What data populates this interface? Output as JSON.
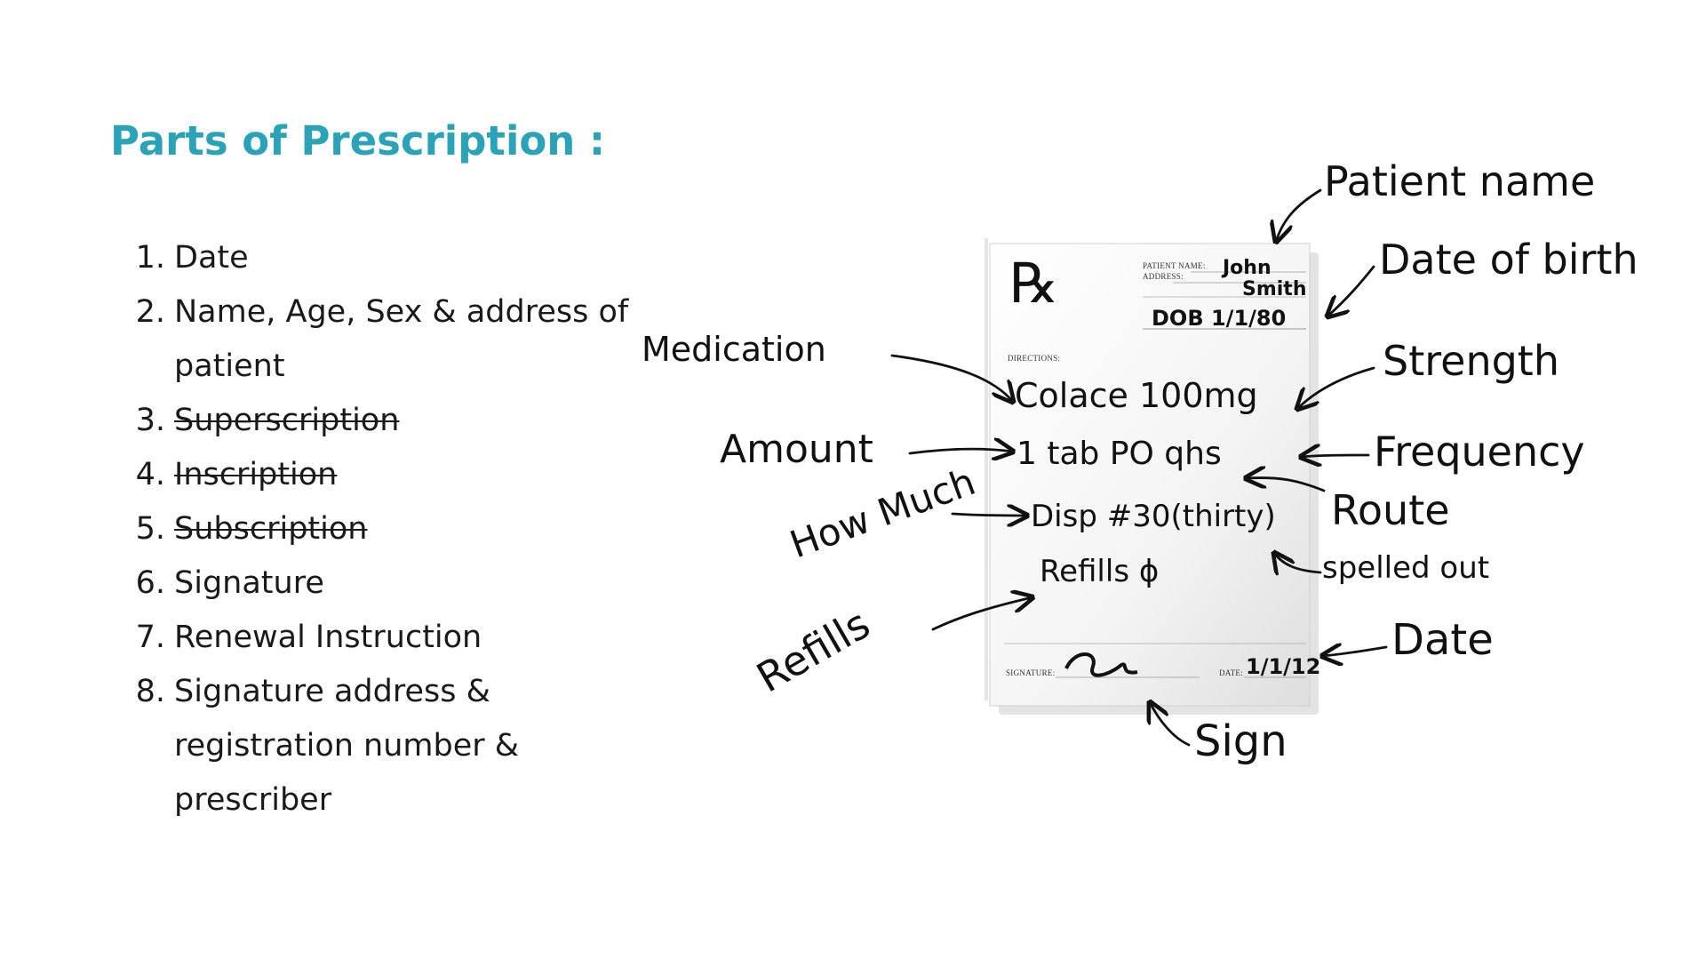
{
  "title": "Parts of Prescription :",
  "accent_color": "#2aa3b8",
  "parts": [
    {
      "n": "1.",
      "label": "Date",
      "struck": false
    },
    {
      "n": "2.",
      "label": "Name, Age, Sex & address of patient",
      "struck": false
    },
    {
      "n": "3.",
      "label": "Superscription",
      "struck": true
    },
    {
      "n": "4.",
      "label": "Inscription",
      "struck": true
    },
    {
      "n": "5.",
      "label": "Subscription",
      "struck": true
    },
    {
      "n": "6.",
      "label": "Signature",
      "struck": false
    },
    {
      "n": "7.",
      "label": "Renewal Instruction",
      "struck": false
    },
    {
      "n": "8.",
      "label": "Signature address & registration number & prescriber",
      "struck": false
    }
  ],
  "prescription": {
    "rx_symbol": "℞",
    "patient_name_label": "PATIENT NAME:",
    "address_label": "ADDRESS:",
    "patient_name_first": "John",
    "patient_name_last": "Smith",
    "dob_text": "DOB 1/1/80",
    "directions_label": "DIRECTIONS:",
    "line_medication": "Colace 100mg",
    "line_amount": "1 tab PO qhs",
    "line_dispense": "Disp #30(thirty)",
    "line_refills": "Refills ϕ",
    "signature_label": "SIGNATURE:",
    "date_label": "DATE:",
    "date_value": "1/1/12"
  },
  "annotations": {
    "patient_name": "Patient name",
    "date_of_birth": "Date of birth",
    "medication": "Medication",
    "strength": "Strength",
    "amount": "Amount",
    "frequency": "Frequency",
    "how_much": "How Much",
    "route": "Route",
    "spelled_out": "spelled out",
    "refills": "Refills",
    "date": "Date",
    "sign": "Sign"
  }
}
